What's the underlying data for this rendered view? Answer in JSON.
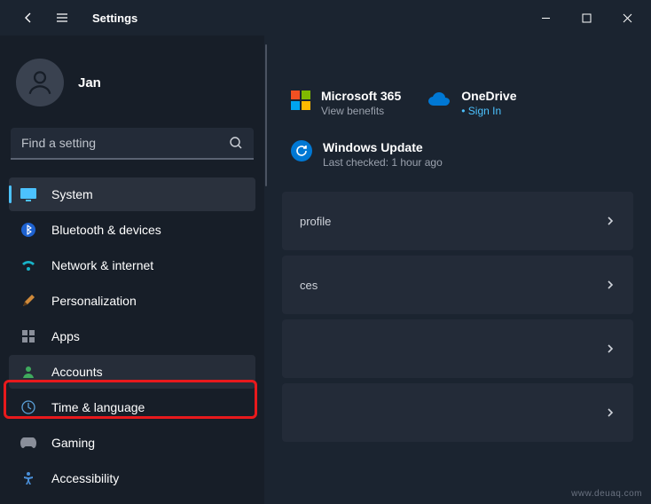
{
  "window": {
    "title": "Settings"
  },
  "profile": {
    "name": "Jan"
  },
  "search": {
    "placeholder": "Find a setting"
  },
  "sidebar": {
    "items": [
      {
        "label": "System"
      },
      {
        "label": "Bluetooth & devices"
      },
      {
        "label": "Network & internet"
      },
      {
        "label": "Personalization"
      },
      {
        "label": "Apps"
      },
      {
        "label": "Accounts"
      },
      {
        "label": "Time & language"
      },
      {
        "label": "Gaming"
      },
      {
        "label": "Accessibility"
      }
    ]
  },
  "content": {
    "ms365": {
      "title": "Microsoft 365",
      "sub": "View benefits"
    },
    "onedrive": {
      "title": "OneDrive",
      "sub": "Sign In"
    },
    "update": {
      "title": "Windows Update",
      "sub": "Last checked: 1 hour ago"
    },
    "rows": [
      {
        "label": "profile"
      },
      {
        "label": "ces"
      },
      {
        "label": ""
      },
      {
        "label": ""
      }
    ]
  },
  "watermark": "www.deuaq.com"
}
